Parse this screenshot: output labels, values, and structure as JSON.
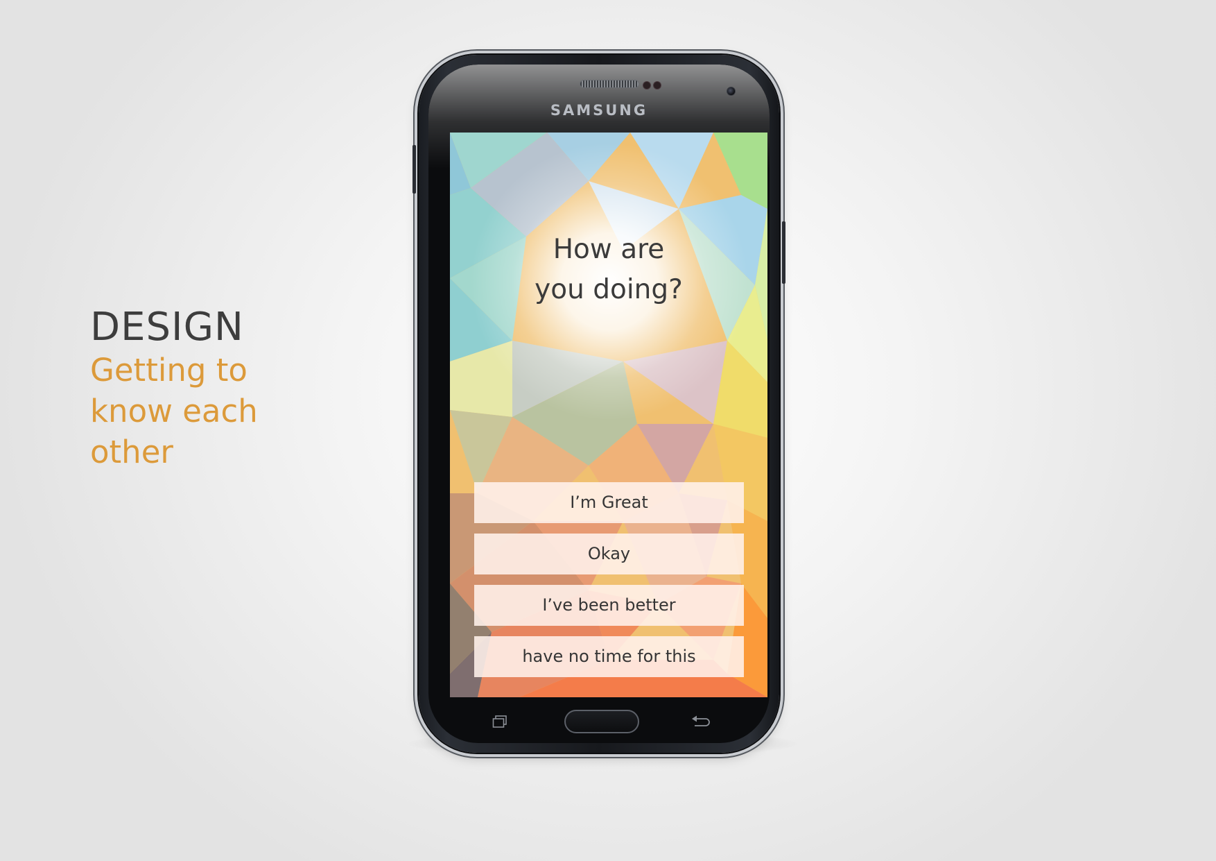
{
  "caption": {
    "title": "DESIGN",
    "subtitle": "Getting to\nknow each\nother"
  },
  "phone": {
    "brand": "SAMSUNG"
  },
  "screen": {
    "question": "How are\nyou doing?",
    "answers": [
      "I’m Great",
      "Okay",
      "I’ve been better",
      "have no time for this"
    ]
  },
  "icons": {
    "recent_apps": "recent-apps-icon",
    "home": "home-button",
    "back": "back-icon",
    "front_camera": "front-camera-icon"
  },
  "colors": {
    "caption_title": "#3d3d3d",
    "caption_subtitle": "#dc9a3a",
    "question_text": "#3b3b3b",
    "answer_bg": "#fff1ec"
  }
}
